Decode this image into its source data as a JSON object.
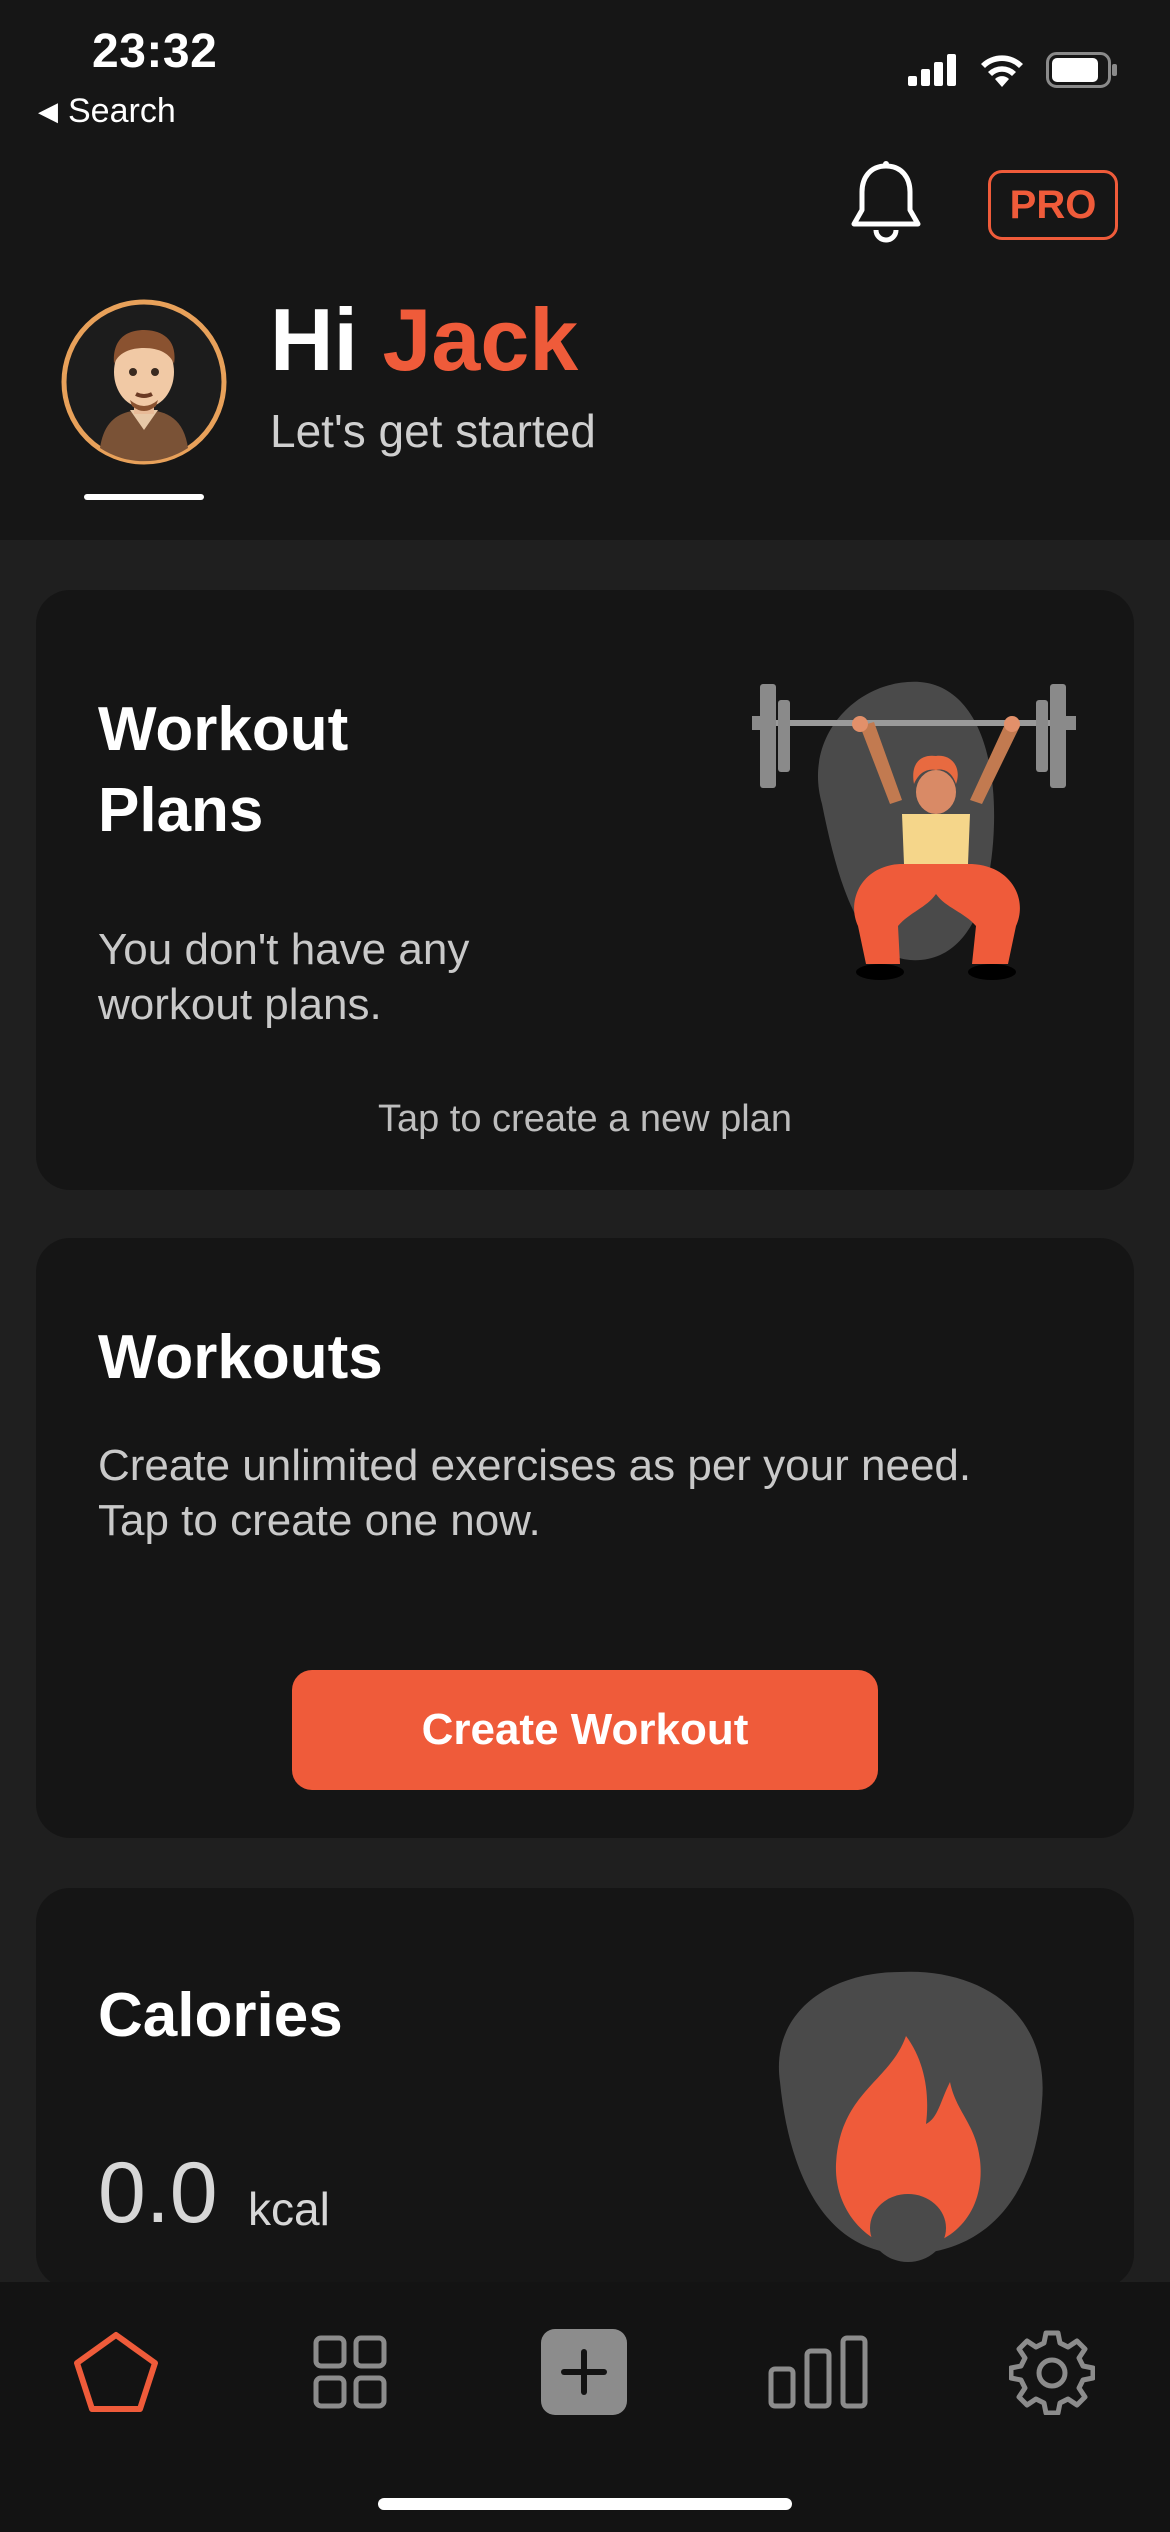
{
  "status_bar": {
    "time": "23:32",
    "back_label": "Search"
  },
  "header": {
    "pro_label": "PRO",
    "greeting_prefix": "Hi ",
    "user_name": "Jack",
    "subtitle": "Let's get started"
  },
  "cards": {
    "workout_plans": {
      "title_line1": "Workout",
      "title_line2": "Plans",
      "text_line1": "You don't have any",
      "text_line2": "workout plans.",
      "hint": "Tap to create a new plan"
    },
    "workouts": {
      "title": "Workouts",
      "text_line1": "Create unlimited exercises as per your need.",
      "text_line2": "Tap to create one now.",
      "button_label": "Create Workout"
    },
    "calories": {
      "title": "Calories",
      "value": "0.0",
      "unit": "kcal"
    }
  },
  "tab_bar": {
    "items": [
      {
        "icon": "pentagon-home-icon",
        "active": true
      },
      {
        "icon": "grid-icon",
        "active": false
      },
      {
        "icon": "plus-icon",
        "active": false
      },
      {
        "icon": "bar-chart-icon",
        "active": false
      },
      {
        "icon": "gear-icon",
        "active": false
      }
    ]
  },
  "colors": {
    "accent": "#ef5b3a",
    "background": "#1f1f1f",
    "card": "#151515"
  }
}
